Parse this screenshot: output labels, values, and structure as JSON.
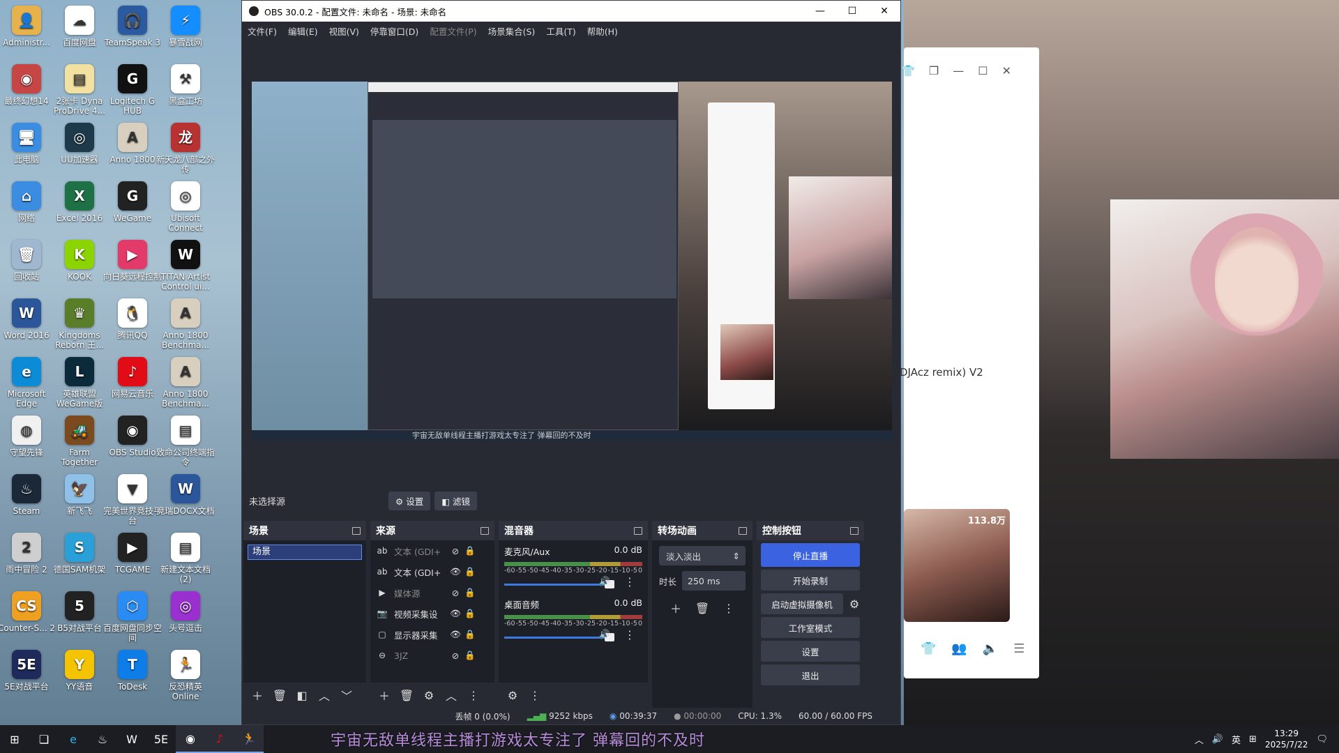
{
  "desktop": {
    "icons": [
      {
        "label": "Administr...",
        "color": "#e7b14b",
        "glyph": "👤"
      },
      {
        "label": "百度网盘",
        "color": "#ffffff",
        "glyph": "☁"
      },
      {
        "label": "TeamSpeak 3",
        "color": "#2c5aa0",
        "glyph": "🎧"
      },
      {
        "label": "暴雪战网",
        "color": "#148eff",
        "glyph": "⚡"
      },
      {
        "label": "最终幻想14",
        "color": "#c64545",
        "glyph": "◉"
      },
      {
        "label": "2张卡 Dyna ProDrive 4...",
        "color": "#f2e1a0",
        "glyph": "▤"
      },
      {
        "label": "Logitech G HUB",
        "color": "#111111",
        "glyph": "G"
      },
      {
        "label": "黑盒工坊",
        "color": "#ffffff",
        "glyph": "⚒"
      },
      {
        "label": "此电脑",
        "color": "#3a8de0",
        "glyph": "🖥"
      },
      {
        "label": "UU加速器",
        "color": "#1e3a4a",
        "glyph": "◎"
      },
      {
        "label": "Anno 1800",
        "color": "#d8cfbf",
        "glyph": "A"
      },
      {
        "label": "新天龙八部之外传",
        "color": "#b83232",
        "glyph": "龙"
      },
      {
        "label": "网络",
        "color": "#3a8de0",
        "glyph": "⌂"
      },
      {
        "label": "Excel 2016",
        "color": "#1e7145",
        "glyph": "X"
      },
      {
        "label": "WeGame",
        "color": "#222222",
        "glyph": "G"
      },
      {
        "label": "Ubisoft Connect",
        "color": "#ffffff",
        "glyph": "◎"
      },
      {
        "label": "回收站",
        "color": "#9fb8d0",
        "glyph": "🗑"
      },
      {
        "label": "KOOK",
        "color": "#8bd400",
        "glyph": "K"
      },
      {
        "label": "向日葵远程控制",
        "color": "#e23b6a",
        "glyph": "▶"
      },
      {
        "label": "TITAN Artist Control ui...",
        "color": "#111111",
        "glyph": "W"
      },
      {
        "label": "Word 2016",
        "color": "#2b579a",
        "glyph": "W"
      },
      {
        "label": "Kingdoms Reborn 王...",
        "color": "#5a7d2a",
        "glyph": "♛"
      },
      {
        "label": "腾讯QQ",
        "color": "#ffffff",
        "glyph": "🐧"
      },
      {
        "label": "Anno 1800 Benchma...",
        "color": "#d8cfbf",
        "glyph": "A"
      },
      {
        "label": "Microsoft Edge",
        "color": "#0c8bd6",
        "glyph": "e"
      },
      {
        "label": "英雄联盟WeGame版",
        "color": "#0b2a3a",
        "glyph": "L"
      },
      {
        "label": "网易云音乐",
        "color": "#e20c16",
        "glyph": "♪"
      },
      {
        "label": "Anno 1800 Benchma...",
        "color": "#d8cfbf",
        "glyph": "A"
      },
      {
        "label": "守望先锋",
        "color": "#f0f0f0",
        "glyph": "◍"
      },
      {
        "label": "Farm Together",
        "color": "#7b4a1e",
        "glyph": "🚜"
      },
      {
        "label": "OBS Studio",
        "color": "#222222",
        "glyph": "◉"
      },
      {
        "label": "致命公司终端指令",
        "color": "#ffffff",
        "glyph": "▤"
      },
      {
        "label": "Steam",
        "color": "#1b2838",
        "glyph": "♨"
      },
      {
        "label": "新飞飞",
        "color": "#8fc1e8",
        "glyph": "🦅"
      },
      {
        "label": "完美世界竞技平台",
        "color": "#ffffff",
        "glyph": "▼"
      },
      {
        "label": "竞瑞DOCX文档",
        "color": "#2b579a",
        "glyph": "W"
      },
      {
        "label": "雨中冒险 2",
        "color": "#cfcfcf",
        "glyph": "2"
      },
      {
        "label": "德国SAM机架",
        "color": "#2aa0d8",
        "glyph": "S"
      },
      {
        "label": "TCGAME",
        "color": "#222222",
        "glyph": "▶"
      },
      {
        "label": "新建文本文档 (2)",
        "color": "#ffffff",
        "glyph": "▤"
      },
      {
        "label": "Counter-S... 2",
        "color": "#f0a020",
        "glyph": "CS"
      },
      {
        "label": "B5对战平台",
        "color": "#222222",
        "glyph": "5"
      },
      {
        "label": "百度网盘同步空间",
        "color": "#2a8bf2",
        "glyph": "⬡"
      },
      {
        "label": "头号逗击",
        "color": "#9a30d0",
        "glyph": "◎"
      },
      {
        "label": "5E对战平台",
        "color": "#1e2a5a",
        "glyph": "5E"
      },
      {
        "label": "YY语音",
        "color": "#f5c400",
        "glyph": "Y"
      },
      {
        "label": "ToDesk",
        "color": "#0e7de8",
        "glyph": "T"
      },
      {
        "label": "反恐精英 Online",
        "color": "#ffffff",
        "glyph": "🏃"
      }
    ]
  },
  "obs": {
    "title": "OBS 30.0.2 - 配置文件: 未命名 - 场景: 未命名",
    "menu": [
      "文件(F)",
      "编辑(E)",
      "视图(V)",
      "停靠窗口(D)",
      "配置文件(P)",
      "场景集合(S)",
      "工具(T)",
      "帮助(H)"
    ],
    "preview_danmaku": "宇宙无敌单线程主播打游戏太专注了 弹幕回的不及时",
    "source_bar": {
      "label": "未选择源",
      "settings": "设置",
      "filters": "滤镜"
    },
    "docks": {
      "scenes": {
        "title": "场景",
        "items": [
          "场景"
        ]
      },
      "sources": {
        "title": "来源",
        "items": [
          {
            "icon": "ab",
            "name": "文本 (GDI+",
            "visible": false
          },
          {
            "icon": "ab",
            "name": "文本 (GDI+",
            "visible": true
          },
          {
            "icon": "▶",
            "name": "媒体源",
            "visible": false
          },
          {
            "icon": "📷",
            "name": "视频采集设",
            "visible": true
          },
          {
            "icon": "▢",
            "name": "显示器采集",
            "visible": true
          },
          {
            "icon": "⊖",
            "name": "3JZ",
            "visible": false
          }
        ]
      },
      "mixer": {
        "title": "混音器",
        "channels": [
          {
            "name": "麦克风/Aux",
            "db": "0.0 dB",
            "level": 0.95
          },
          {
            "name": "桌面音频",
            "db": "0.0 dB",
            "level": 0.95
          }
        ],
        "scale": [
          "-60",
          "-55",
          "-50",
          "-45",
          "-40",
          "-35",
          "-30",
          "-25",
          "-20",
          "-15",
          "-10",
          "-5",
          "0"
        ]
      },
      "transitions": {
        "title": "转场动画",
        "selected": "淡入淡出",
        "duration_label": "时长",
        "duration": "250 ms"
      },
      "controls": {
        "title": "控制按钮",
        "stream": "停止直播",
        "record": "开始录制",
        "virtualcam": "启动虚拟摄像机",
        "studio": "工作室模式",
        "settings": "设置",
        "exit": "退出"
      }
    },
    "status": {
      "dropped": "丢帧 0 (0.0%)",
      "bitrate": "9252 kbps",
      "stream_time": "00:39:37",
      "record_time": "00:00:00",
      "cpu": "CPU: 1.3%",
      "fps": "60.00 / 60.00 FPS"
    }
  },
  "right_panel": {
    "song": "DJAcz remix)  V2",
    "thumb_badge": "113.8万"
  },
  "taskbar": {
    "danmaku": "宇宙无敌单线程主播打游戏太专注了 弹幕回的不及时",
    "tray_ime": "英",
    "time": "13:29",
    "date": "2025/7/22"
  }
}
